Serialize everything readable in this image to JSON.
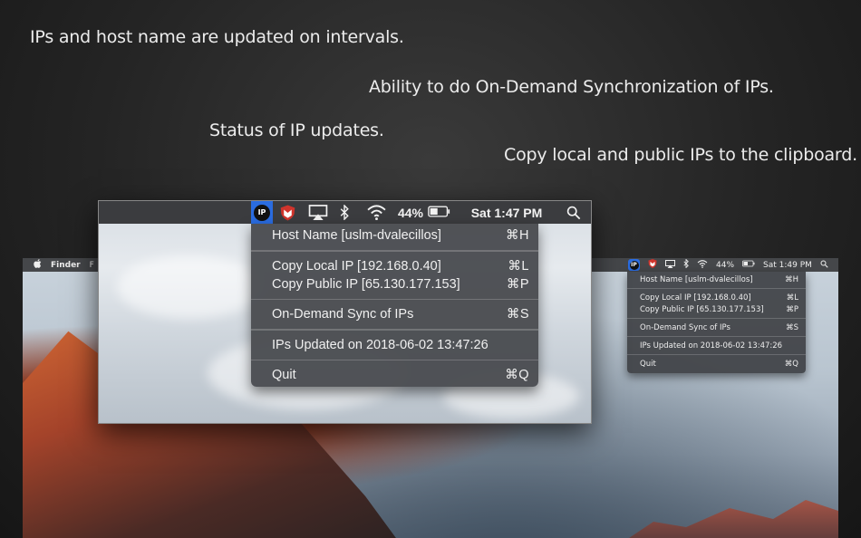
{
  "captions": [
    "IPs and host name are updated on intervals.",
    "Ability to do On-Demand Synchronization of IPs.",
    "Status of IP updates.",
    "Copy local and public IPs to the clipboard."
  ],
  "desktop_menubar": {
    "apple": "",
    "app_name": "Finder",
    "first_menu": "F"
  },
  "big_menubar": {
    "ip_icon_text": "IP",
    "battery": "44%",
    "clock": "Sat 1:47 PM"
  },
  "small_menubar": {
    "battery": "44%",
    "clock": "Sat 1:49 PM"
  },
  "menu": {
    "host_name": {
      "label": "Host Name [uslm-dvalecillos]",
      "shortcut": "⌘H"
    },
    "copy_local": {
      "label": "Copy Local IP [192.168.0.40]",
      "shortcut": "⌘L"
    },
    "copy_public": {
      "label": "Copy Public IP [65.130.177.153]",
      "shortcut": "⌘P"
    },
    "sync": {
      "label": "On-Demand Sync of IPs",
      "shortcut": "⌘S"
    },
    "status": {
      "label": "IPs Updated on 2018-06-02 13:47:26"
    },
    "quit": {
      "label": "Quit",
      "shortcut": "⌘Q"
    }
  },
  "icons": {
    "ip": "ip-status-icon",
    "shield": "mcafee-shield-icon",
    "airplay": "airplay-icon",
    "bluetooth": "bluetooth-icon",
    "wifi": "wifi-icon",
    "battery": "battery-icon",
    "search": "spotlight-search-icon"
  },
  "colors": {
    "ip_highlight": "#2a6ce0",
    "shield_red": "#d0342c",
    "menubar": "#3b3c3f",
    "menu_bg": "#4a4c50"
  }
}
